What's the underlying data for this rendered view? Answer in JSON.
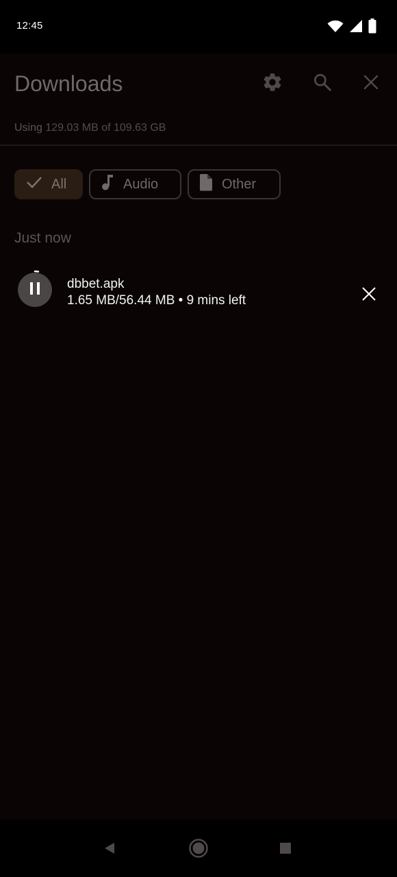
{
  "status_bar": {
    "time": "12:45",
    "icons": [
      "wifi-icon",
      "cellular-signal-icon",
      "battery-icon"
    ]
  },
  "header": {
    "title": "Downloads",
    "actions": [
      "settings-icon",
      "search-icon",
      "close-icon"
    ]
  },
  "storage": {
    "prefix": "Using",
    "value": "129.03 MB of 109.63 GB"
  },
  "filters": [
    {
      "label": "All",
      "icon": "check-icon",
      "selected": true
    },
    {
      "label": "Audio",
      "icon": "music-note-icon",
      "selected": false
    },
    {
      "label": "Other",
      "icon": "file-icon",
      "selected": false
    }
  ],
  "section": {
    "title": "Just now"
  },
  "downloads": [
    {
      "file_name": "dbbet.apk",
      "progress_text": "1.65 MB/56.44 MB • 9 mins left",
      "progress_fraction": 0.029,
      "state": "downloading",
      "action_icon": "pause-icon",
      "cancel_icon": "close-icon"
    }
  ],
  "nav_bar": {
    "buttons": [
      "back-icon",
      "home-icon",
      "recents-icon"
    ]
  },
  "colors": {
    "background": "#0a0404",
    "selected_chip": "#2a1d14",
    "text_primary": "#f3f3f3",
    "text_dimmed": "#6f6a69"
  }
}
